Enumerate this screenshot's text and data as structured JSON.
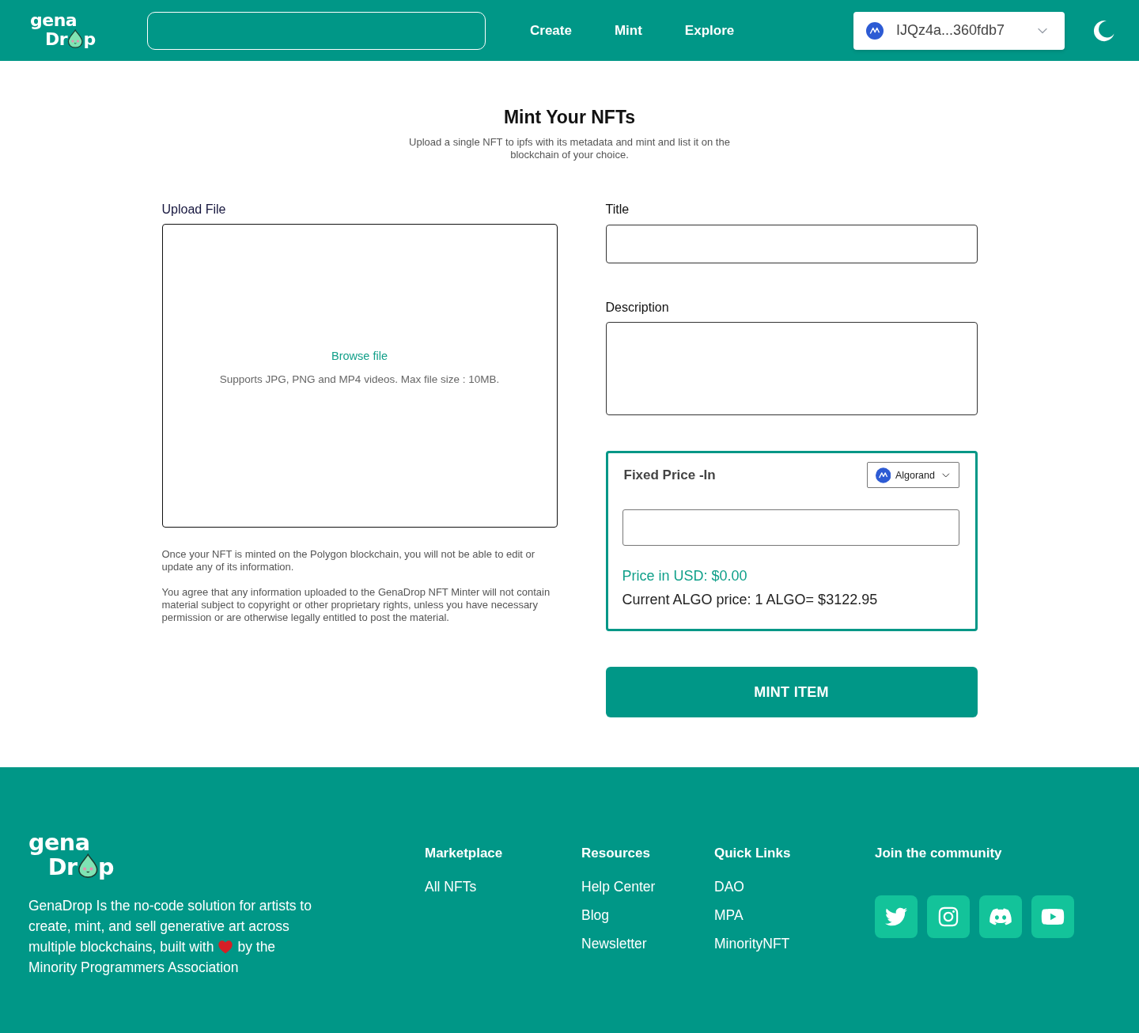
{
  "header": {
    "logo": {
      "top": "gena",
      "left": "Dr",
      "right": "p"
    },
    "nav": [
      {
        "label": "Create"
      },
      {
        "label": "Mint"
      },
      {
        "label": "Explore"
      }
    ],
    "wallet": {
      "address": "IJQz4a...360fdb7"
    }
  },
  "intro": {
    "title": "Mint Your NFTs",
    "subtitle": "Upload a single NFT to ipfs with its metadata and mint and list it on the blockchain of your choice."
  },
  "upload": {
    "label": "Upload File",
    "browse": "Browse file",
    "hint": "Supports JPG, PNG and MP4 videos. Max file size : 10MB.",
    "notes": [
      "Once your NFT is minted on the Polygon blockchain, you will not be able to edit or update any of its information.",
      "You agree that any information uploaded to the GenaDrop NFT Minter will not contain material subject to copyright or other proprietary rights, unless you have necessary permission or are otherwise legally entitled to post the material."
    ]
  },
  "fields": [
    {
      "label": "Title",
      "kind": "input"
    },
    {
      "label": "Description",
      "kind": "textarea"
    }
  ],
  "price": {
    "title": "Fixed Price -In",
    "chain": "Algorand",
    "usd": "Price in USD: $0.00",
    "rate": "Current ALGO price: 1 ALGO= $3122.95"
  },
  "mint_button": {
    "label": "MINT ITEM"
  },
  "footer": {
    "logo": {
      "top": "gena",
      "left": "Dr",
      "right": "p"
    },
    "about_lines": [
      [
        {
          "kind": "text",
          "text": "GenaDrop Is the no-code solution for artists to"
        }
      ],
      [
        {
          "kind": "text",
          "text": "create, mint, and sell generative art across"
        }
      ],
      [
        {
          "kind": "text",
          "text": "multiple blockchains, built with"
        },
        {
          "kind": "heart"
        },
        {
          "kind": "text",
          "text": "by the"
        }
      ],
      [
        {
          "kind": "text",
          "text": "Minority Programmers Association"
        }
      ]
    ],
    "columns": [
      {
        "title": "Marketplace",
        "links": [
          "All NFTs"
        ]
      },
      {
        "title": "Resources",
        "links": [
          "Help Center",
          "Blog",
          "Newsletter"
        ]
      },
      {
        "title": "Quick Links",
        "links": [
          "DAO",
          "MPA",
          "MinorityNFT"
        ]
      }
    ],
    "community": {
      "title": "Join the community",
      "links": [
        {
          "kind": "twitter"
        },
        {
          "kind": "instagram"
        },
        {
          "kind": "discord"
        },
        {
          "kind": "youtube"
        }
      ]
    }
  }
}
